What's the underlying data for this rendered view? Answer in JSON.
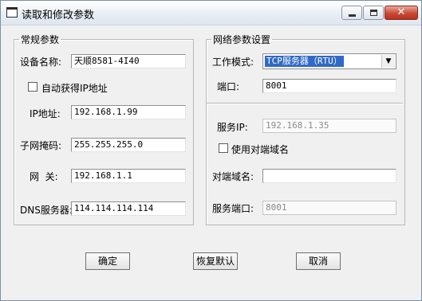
{
  "window": {
    "title": "读取和修改参数",
    "minimize_label": "minimize",
    "maximize_label": "maximize",
    "close_label": "close"
  },
  "general": {
    "legend": "常规参数",
    "device_name_label": "设备名称:",
    "device_name_value": "天顺8581-4I40",
    "auto_ip_label": "自动获得IP地址",
    "auto_ip_checked": false,
    "ip_label": "IP地址:",
    "ip_value": "192.168.1.99",
    "subnet_label": "子网掩码:",
    "subnet_value": "255.255.255.0",
    "gateway_label": "网  关:",
    "gateway_value": "192.168.1.1",
    "dns_label": "DNS服务器:",
    "dns_value": "114.114.114.114"
  },
  "network": {
    "legend": "网络参数设置",
    "mode_label": "工作模式:",
    "mode_value": "TCP服务器（RTU）",
    "port_label": "端口:",
    "port_value": "8001",
    "server_ip_label": "服务IP:",
    "server_ip_value": "192.168.1.35",
    "use_peer_domain_label": "使用对端域名",
    "use_peer_domain_checked": false,
    "peer_domain_label": "对端域名:",
    "peer_domain_value": "",
    "server_port_label": "服务端口:",
    "server_port_value": "8001"
  },
  "buttons": {
    "ok": "确定",
    "restore_default": "恢复默认",
    "cancel": "取消"
  }
}
